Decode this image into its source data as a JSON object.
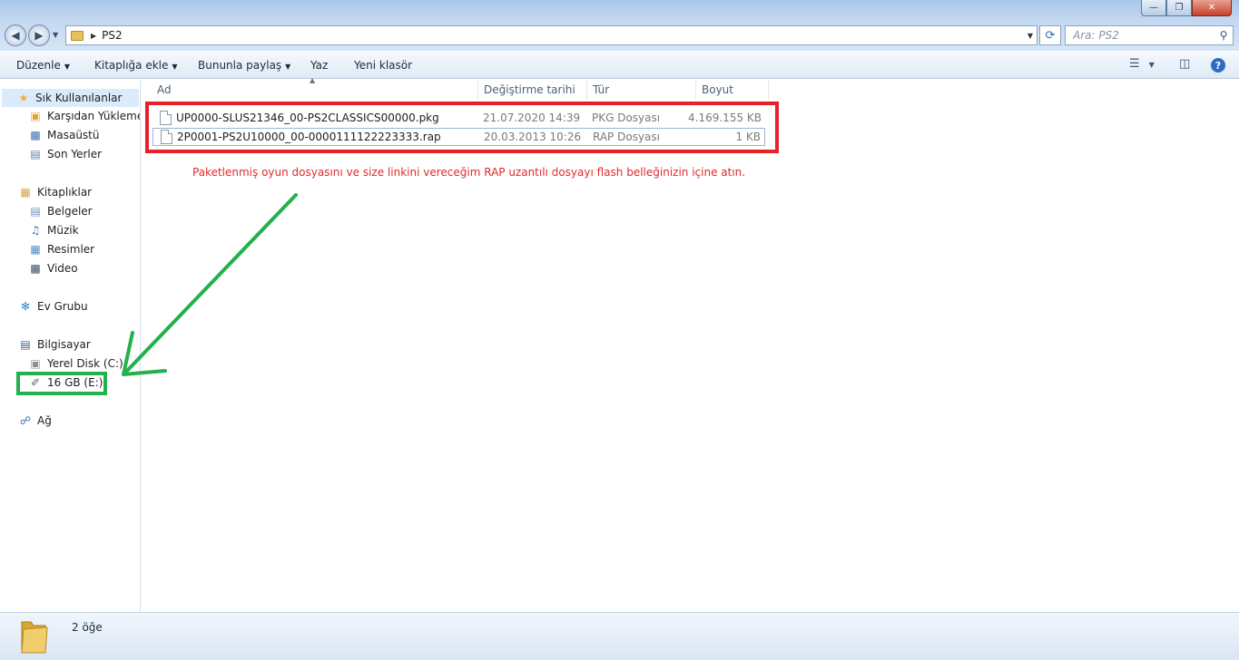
{
  "window": {
    "controls": {
      "minimize": "0",
      "maximize": "1",
      "close": "r"
    }
  },
  "address": {
    "path_segment": "PS2",
    "search_placeholder": "Ara: PS2"
  },
  "toolbar": {
    "organize": "Düzenle",
    "include_library": "Kitaplığa ekle",
    "share_with": "Bunun­la paylaş",
    "burn": "Yaz",
    "new_folder": "Yeni klasör"
  },
  "nav": {
    "favorites": "Sık Kullanılanlar",
    "downloads": "Karşıdan Yüklemeler",
    "desktop": "Masaüstü",
    "recent": "Son Yerler",
    "libraries": "Kitaplıklar",
    "documents": "Belgeler",
    "music": "Müzik",
    "pictures": "Resimler",
    "videos": "Video",
    "homegroup": "Ev Grubu",
    "computer": "Bilgisayar",
    "local_disk": "Yerel Disk (C:)",
    "usb_drive": "16 GB (E:)",
    "network": "Ağ"
  },
  "columns": {
    "name": "Ad",
    "date": "Değiştirme tarihi",
    "type": "Tür",
    "size": "Boyut"
  },
  "files": [
    {
      "name": "UP0000-SLUS21346_00-PS2CLASSICS00000.pkg",
      "date": "21.07.2020 14:39",
      "type": "PKG Dosyası",
      "size": "4.169.155 KB"
    },
    {
      "name": "2P0001-PS2U10000_00-0000111122223333.rap",
      "date": "20.03.2013 10:26",
      "type": "RAP Dosyası",
      "size": "1 KB"
    }
  ],
  "annotation": {
    "text": "Paketlenmiş oyun dosyasını ve size linkini vereceğim RAP uzantılı dosyayı flash belleğinizin içine atın.",
    "red_color": "#e8202a",
    "green_color": "#22b14c"
  },
  "status": {
    "item_count": "2 öğe"
  }
}
